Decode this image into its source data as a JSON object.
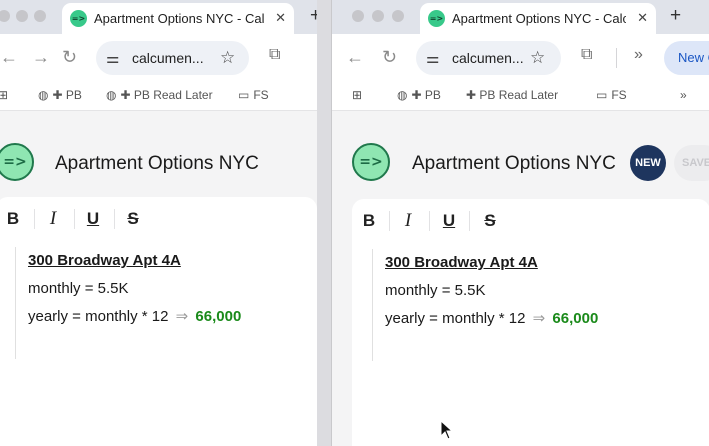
{
  "tab": {
    "favicon": "=>",
    "title": "Apartment Options NYC - Calcumention",
    "close": "✕",
    "new_tab": "+"
  },
  "left_window": {
    "url": "calcumen...",
    "bookmarks": [
      "PB",
      "PB Read Later",
      "FS"
    ]
  },
  "right_window": {
    "url": "calcumen...",
    "bookmarks": [
      "PB",
      "PB Read Later",
      "FS"
    ],
    "new_tab_pill": "New C"
  },
  "app": {
    "logo": "=>",
    "title": "Apartment Options NYC",
    "new_label": "NEW",
    "save_label": "SAVE"
  },
  "toolbar_buttons": [
    "B",
    "I",
    "U",
    "S"
  ],
  "document": {
    "heading": "300 Broadway Apt 4A",
    "line2": "monthly = 5.5K",
    "line3_expr": "yearly = monthly * 12",
    "line3_arrow": "⇒",
    "line3_result": "66,000"
  },
  "icons": {
    "back": "arrow-left-icon",
    "forward": "arrow-right-icon",
    "reload": "reload-icon",
    "star": "star-icon",
    "extensions": "puzzle-icon",
    "apps": "apps-grid-icon",
    "globe": "globe-icon",
    "folder": "folder-icon"
  },
  "colors": {
    "accent_green": "#1a8a1a",
    "logo_bg": "#8fe6b2",
    "new_button": "#1e355e"
  }
}
